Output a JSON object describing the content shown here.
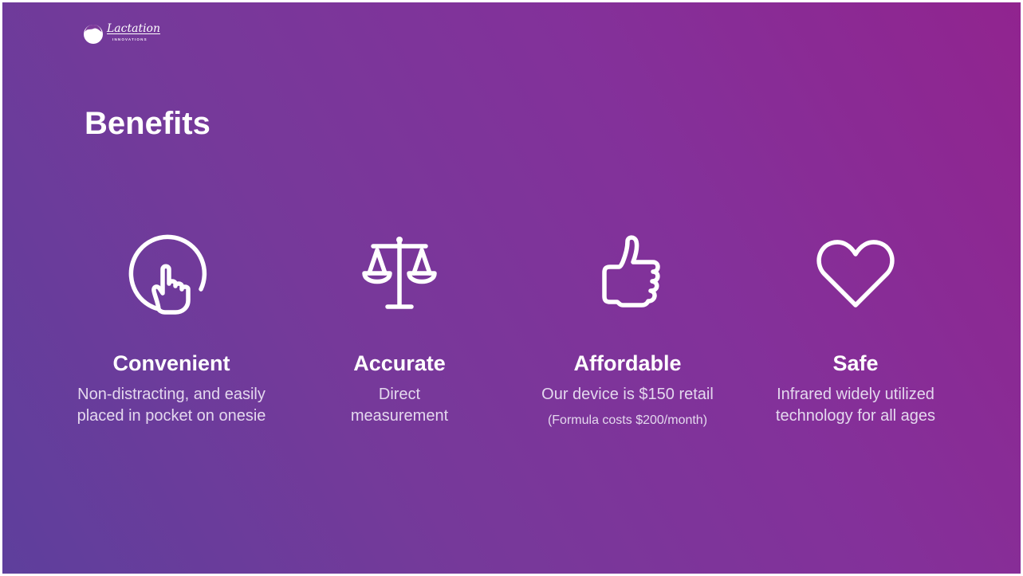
{
  "brand": {
    "wordmark": "Lactation",
    "sub": "INNOVATIONS"
  },
  "slide": {
    "title": "Benefits"
  },
  "benefits": [
    {
      "icon": "touch-hand-icon",
      "title": "Convenient",
      "desc_lines": [
        "Non-distracting, and easily",
        "placed in pocket on onesie"
      ]
    },
    {
      "icon": "scales-icon",
      "title": "Accurate",
      "desc_lines": [
        "Direct",
        "measurement"
      ]
    },
    {
      "icon": "thumbs-up-icon",
      "title": "Affordable",
      "desc_lines": [
        "Our device is $150 retail"
      ],
      "note": "(Formula costs $200/month)"
    },
    {
      "icon": "heart-icon",
      "title": "Safe",
      "desc_lines": [
        "Infrared widely utilized",
        "technology for all ages"
      ]
    }
  ],
  "colors": {
    "gradient_start": "#5e3f9c",
    "gradient_end": "#91248f",
    "text": "#ffffff",
    "text_muted": "#e4d8ee"
  }
}
